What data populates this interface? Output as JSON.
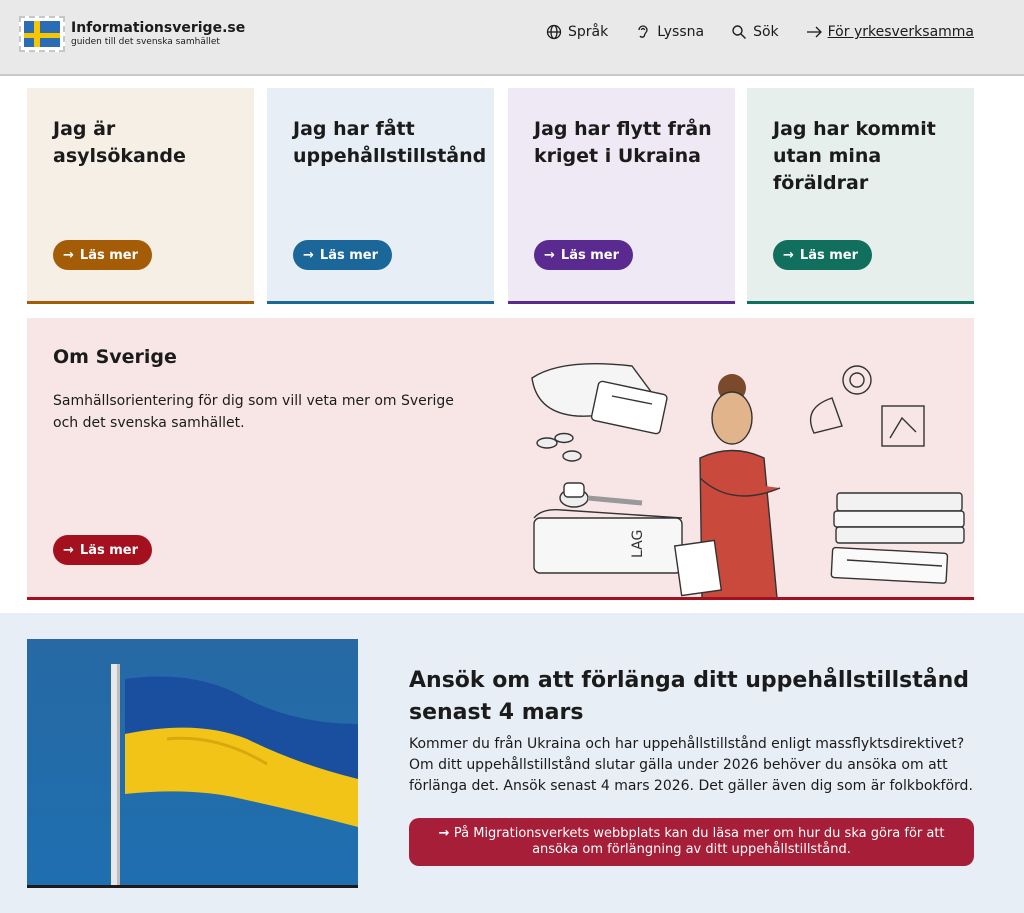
{
  "header": {
    "logo_title": "Informationsverige.se",
    "logo_subtitle": "guiden till det svenska samhället",
    "nav": {
      "language": "Språk",
      "listen": "Lyssna",
      "search": "Sök",
      "professionals": "För yrkesverksamma"
    }
  },
  "cards": [
    {
      "title": "Jag är asylsökande",
      "button": "Läs mer",
      "accent": "#a45c06"
    },
    {
      "title": "Jag har fått uppehållstillstånd",
      "button": "Läs mer",
      "accent": "#1b6799"
    },
    {
      "title": "Jag har flytt från kriget i Ukraina",
      "button": "Läs mer",
      "accent": "#5a2a90"
    },
    {
      "title": "Jag har kommit utan mina föräldrar",
      "button": "Läs mer",
      "accent": "#10705d"
    }
  ],
  "om_sverige": {
    "title": "Om Sverige",
    "text": "Samhällsorientering för dig som vill veta mer om Sverige och det svenska samhället.",
    "button": "Läs mer",
    "book_label": "LAG"
  },
  "news": {
    "title": "Ansök om att förlänga ditt uppehållstillstånd senast 4 mars",
    "text": "Kommer du från Ukraina och har uppehållstillstånd enligt massflyktsdirektivet? Om ditt uppehållstillstånd slutar gälla under 2026 behöver du ansöka om att förlänga det. Ansök senast 4 mars 2026. Det gäller även dig som är folkbokförd.",
    "cta": "På Migrationsverkets webbplats kan du läsa mer om hur du ska göra för att ansöka om förlängning av ditt uppehållstillstånd."
  }
}
